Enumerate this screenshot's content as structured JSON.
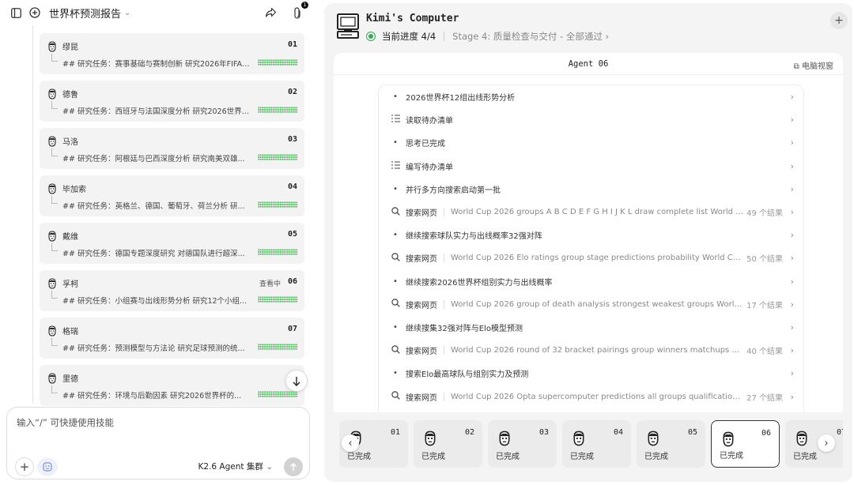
{
  "header": {
    "title": "世界杯预测报告",
    "attachment_badge": "1"
  },
  "agents": [
    {
      "name": "缪昆",
      "num": "01",
      "task": "## 研究任务：赛事基础与赛制创新 研究2026年FIFA世界杯...",
      "status": ""
    },
    {
      "name": "德鲁",
      "num": "02",
      "task": "## 研究任务：西班牙与法国深度分析 研究2026世界杯...",
      "status": ""
    },
    {
      "name": "马洛",
      "num": "03",
      "task": "## 研究任务：阿根廷与巴西深度分析 研究南美双雄...",
      "status": ""
    },
    {
      "name": "毕加索",
      "num": "04",
      "task": "## 研究任务：英格兰、德国、葡萄牙、荷兰分析 研...",
      "status": ""
    },
    {
      "name": "戴维",
      "num": "05",
      "task": "## 研究任务：德国专题深度研究 对德国队进行超深...",
      "status": ""
    },
    {
      "name": "孚柯",
      "num": "06",
      "task": "## 研究任务：小组赛与出线形势分析 研究12个小组...",
      "status": "查看中"
    },
    {
      "name": "格瑞",
      "num": "07",
      "task": "## 研究任务：预测模型与方法论 研究足球预测的统...",
      "status": ""
    },
    {
      "name": "里德",
      "num": "",
      "task": "## 研究任务：环境与后勤因素 研究2026世界杯的...",
      "status": ""
    }
  ],
  "input": {
    "placeholder": "输入“/” 可快捷使用技能",
    "model": "K2.6 Agent 集群"
  },
  "computer": {
    "title": "Kimi's Computer",
    "progress_label": "当前进度 4/4",
    "stage": "Stage 4: 质量检查与交付 - 全部通过",
    "agent_label": "Agent 06",
    "view_button": "电脑视窗"
  },
  "steps": [
    {
      "type": "dot",
      "label": "2026世界杯12组出线形势分析",
      "query": "",
      "results": ""
    },
    {
      "type": "list",
      "label": "读取待办清单",
      "query": "",
      "results": ""
    },
    {
      "type": "dot",
      "label": "思考已完成",
      "query": "",
      "results": ""
    },
    {
      "type": "list",
      "label": "编写待办清单",
      "query": "",
      "results": ""
    },
    {
      "type": "dot",
      "label": "并行多方向搜索启动第一批",
      "query": "",
      "results": ""
    },
    {
      "type": "search",
      "label": "搜索网页",
      "query": "World Cup 2026 groups A B C D E F G H I J K L draw complete list World Cup ...",
      "results": "49 个结果"
    },
    {
      "type": "dot",
      "label": "继续搜索球队实力与出线概率32强对阵",
      "query": "",
      "results": ""
    },
    {
      "type": "search",
      "label": "搜索网页",
      "query": "World Cup 2026 Elo ratings group stage predictions probability World Cup 20...",
      "results": "50 个结果"
    },
    {
      "type": "dot",
      "label": "继续搜索2026世界杯组别实力与出线概率",
      "query": "",
      "results": ""
    },
    {
      "type": "search",
      "label": "搜索网页",
      "query": "World Cup 2026 group of death analysis strongest weakest groups World Cup ...",
      "results": "17 个结果"
    },
    {
      "type": "dot",
      "label": "继续搜集32强对阵与Elo模型预测",
      "query": "",
      "results": ""
    },
    {
      "type": "search",
      "label": "搜索网页",
      "query": "World Cup 2026 round of 32 bracket pairings group winners matchups World ...",
      "results": "40 个结果"
    },
    {
      "type": "dot",
      "label": "搜索Elo最高球队与组别实力及预测",
      "query": "",
      "results": ""
    },
    {
      "type": "search",
      "label": "搜索网页",
      "query": "World Cup 2026 Opta supercomputer predictions all groups qualification prob...",
      "results": "27 个结果"
    }
  ],
  "thumbs": [
    {
      "num": "01",
      "status": "已完成",
      "selected": false
    },
    {
      "num": "02",
      "status": "已完成",
      "selected": false
    },
    {
      "num": "03",
      "status": "已完成",
      "selected": false
    },
    {
      "num": "04",
      "status": "已完成",
      "selected": false
    },
    {
      "num": "05",
      "status": "已完成",
      "selected": false
    },
    {
      "num": "06",
      "status": "已完成",
      "selected": true
    },
    {
      "num": "07",
      "status": "已完成",
      "selected": false
    }
  ]
}
